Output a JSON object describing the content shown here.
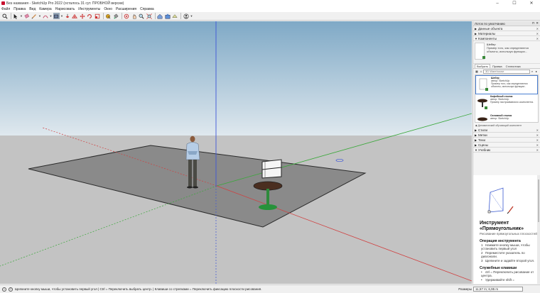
{
  "window": {
    "title": "Без названия - SketchUp Pro 2022 (осталось 31 сут. ПРОБНОЙ версии)",
    "minimize": "–",
    "maximize": "☐",
    "close": "✕"
  },
  "menu": [
    "Файл",
    "Правка",
    "Вид",
    "Камера",
    "Нарисовать",
    "Инструменты",
    "Окно",
    "Расширения",
    "Справка"
  ],
  "toolbar": {
    "tools": [
      "search-icon",
      "select-arrow-icon",
      "eraser-icon",
      "pencil-line-icon",
      "arc-icon",
      "rectangle-icon",
      "push-pull-icon",
      "offset-icon",
      "move-icon",
      "rotate-icon",
      "scale-icon",
      "tape-measure-icon",
      "paint-bucket-icon",
      "orbit-icon",
      "pan-icon",
      "zoom-icon",
      "zoom-extents-icon",
      "warehouse-icon",
      "extension-icon",
      "section-icon",
      "user-icon"
    ]
  },
  "tray": {
    "title": "Лоток по умолчанию",
    "panels_top": [
      {
        "label": "Данные объекта",
        "expanded": false
      },
      {
        "label": "Материалы",
        "expanded": false
      },
      {
        "label": "Компоненты",
        "expanded": true
      }
    ],
    "component_preview": {
      "name": "Шебер",
      "description": "Пример того, как определяются объекты, используя функции..."
    },
    "tabs": [
      "Выбрать",
      "Правка",
      "Статистика"
    ],
    "active_tab": "Выбрать",
    "search_placeholder": "3D Warehouse",
    "components": [
      {
        "name": "Шебер",
        "author": "автор: SketchUp",
        "desc": "Пример того, как определяются объекты, используя функции.."
      },
      {
        "name": "Кофейный столик",
        "author": "автор: SketchUp",
        "desc": "Пример настраиваемого компонента."
      },
      {
        "name": "Основной столик",
        "author": "автор: SketchUp",
        "desc": ""
      }
    ],
    "dynamic_note": "Динамический обучающий компонент",
    "panels_bottom": [
      {
        "label": "Стили",
        "expanded": false
      },
      {
        "label": "Метки",
        "expanded": false
      },
      {
        "label": "Тени",
        "expanded": false
      },
      {
        "label": "Сцены",
        "expanded": false
      },
      {
        "label": "Учебник",
        "expanded": true
      }
    ],
    "instructor": {
      "title": "Инструмент «Прямоугольник»",
      "subtitle": "Рисование прямоугольных плоскостей",
      "operation_heading": "Операция инструмента",
      "steps": [
        "Нажмите кнопку мыши, чтобы установить первый угол",
        "Переместите указатель по диагонали.",
        "Щелкните и задайте второй угол."
      ],
      "keys_heading": "Служебные клавиши",
      "keys": [
        "ctrl = Переключить рисование от центра.",
        "Удерживайте shift ="
      ]
    }
  },
  "status": {
    "text": "Щелкните кнопку мыши, чтобы установить первый угол | Ctrl = Переключить выбрать центр. | Клавиши со стрелками = Переключить фиксацию плоскости рисования.",
    "measure_label": "Размеры",
    "measure_value": "11,57 m; 6,95 m"
  },
  "colors": {
    "sky_top": "#7fa9c6",
    "sky_bottom": "#dfe8ee",
    "ground": "#c3c3c3",
    "plane": "#8a8a8a",
    "axis_red": "#d04040",
    "axis_green": "#3aa83a",
    "axis_blue": "#3f56d8"
  }
}
